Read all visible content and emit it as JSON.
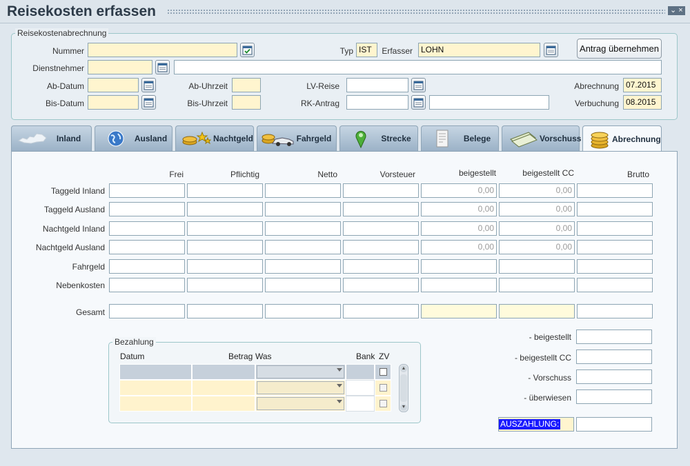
{
  "window": {
    "title": "Reisekosten erfassen",
    "controls": "⌄ ×"
  },
  "header": {
    "section_label": "Reisekostenabrechnung",
    "nummer": {
      "label": "Nummer",
      "value": ""
    },
    "typ": {
      "label": "Typ",
      "value": "IST"
    },
    "erfasser": {
      "label": "Erfasser",
      "value": "LOHN"
    },
    "antrag_button": "Antrag übernehmen",
    "dienstnehmer": {
      "label": "Dienstnehmer",
      "value": "",
      "name": ""
    },
    "ab_datum": {
      "label": "Ab-Datum",
      "value": ""
    },
    "bis_datum": {
      "label": "Bis-Datum",
      "value": ""
    },
    "ab_uhrzeit": {
      "label": "Ab-Uhrzeit",
      "value": ""
    },
    "bis_uhrzeit": {
      "label": "Bis-Uhrzeit",
      "value": ""
    },
    "lv_reise": {
      "label": "LV-Reise",
      "value": ""
    },
    "rk_antrag": {
      "label": "RK-Antrag",
      "value": "",
      "text": ""
    },
    "abrechnung": {
      "label": "Abrechnung",
      "value": "07.2015"
    },
    "verbuchung": {
      "label": "Verbuchung",
      "value": "08.2015"
    }
  },
  "tabs": [
    {
      "label": "Inland",
      "icon": "austria-map-icon"
    },
    {
      "label": "Ausland",
      "icon": "globe-icon"
    },
    {
      "label": "Nachtgeld",
      "icon": "coins-stars-icon"
    },
    {
      "label": "Fahrgeld",
      "icon": "coins-car-icon"
    },
    {
      "label": "Strecke",
      "icon": "map-pin-icon"
    },
    {
      "label": "Belege",
      "icon": "receipt-icon"
    },
    {
      "label": "Vorschuss",
      "icon": "banknotes-icon"
    },
    {
      "label": "Abrechnung",
      "icon": "coins-stack-icon",
      "active": true
    }
  ],
  "abrechnung": {
    "columns": [
      "Frei",
      "Pflichtig",
      "Netto",
      "Vorsteuer",
      "beigestellt",
      "beigestellt CC",
      "Brutto"
    ],
    "rows": [
      {
        "label": "Taggeld Inland",
        "values": [
          "",
          "",
          "",
          "",
          "0,00",
          "0,00",
          ""
        ]
      },
      {
        "label": "Taggeld Ausland",
        "values": [
          "",
          "",
          "",
          "",
          "0,00",
          "0,00",
          ""
        ]
      },
      {
        "label": "Nachtgeld Inland",
        "values": [
          "",
          "",
          "",
          "",
          "0,00",
          "0,00",
          ""
        ]
      },
      {
        "label": "Nachtgeld Ausland",
        "values": [
          "",
          "",
          "",
          "",
          "0,00",
          "0,00",
          ""
        ]
      },
      {
        "label": "Fahrgeld",
        "values": [
          "",
          "",
          "",
          "",
          "",
          "",
          ""
        ]
      },
      {
        "label": "Nebenkosten",
        "values": [
          "",
          "",
          "",
          "",
          "",
          "",
          ""
        ]
      }
    ],
    "total": {
      "label": "Gesamt",
      "values": [
        "",
        "",
        "",
        "",
        "",
        "",
        ""
      ]
    },
    "summary": [
      {
        "label": "- beigestellt",
        "value": ""
      },
      {
        "label": "- beigestellt CC",
        "value": ""
      },
      {
        "label": "- Vorschuss",
        "value": ""
      },
      {
        "label": "- überwiesen",
        "value": ""
      }
    ],
    "auszahlung": {
      "label": "AUSZAHLUNG:",
      "value": ""
    }
  },
  "bezahlung": {
    "section_label": "Bezahlung",
    "columns": {
      "datum": "Datum",
      "betrag": "Betrag",
      "was": "Was",
      "bank": "Bank",
      "zv": "ZV"
    }
  },
  "colors": {
    "required_field": "#fff5cf",
    "accent_tab": "#9bb2c7",
    "auszahlung_highlight": "#1a1aff"
  }
}
